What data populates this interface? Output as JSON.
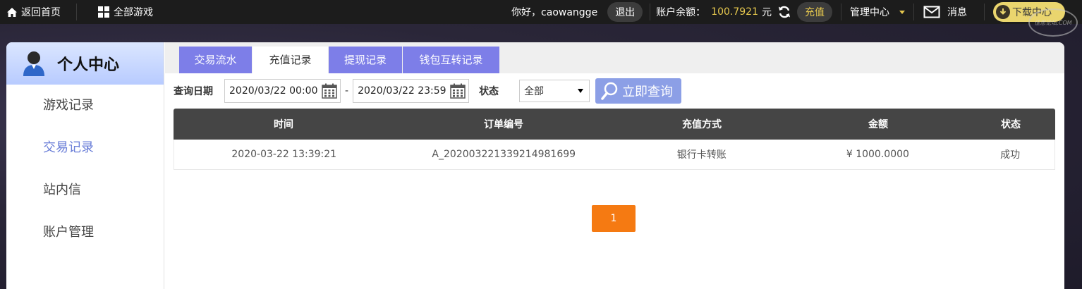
{
  "topbar": {
    "home_label": "返回首页",
    "games_label": "全部游戏",
    "greeting": "你好，caowangge",
    "logout_label": "退出",
    "balance_label": "账户余额：",
    "balance_value": "100.7921",
    "currency": "元",
    "recharge_label": "充值",
    "management_label": "管理中心",
    "messages_label": "消息",
    "download_label": "下载中心",
    "watermark_text": "佳思论坛.COM",
    "accent_color": "#e6c84e"
  },
  "sidebar": {
    "title": "个人中心",
    "items": [
      {
        "label": "游戏记录"
      },
      {
        "label": "交易记录",
        "active": true
      },
      {
        "label": "站内信"
      },
      {
        "label": "账户管理"
      }
    ]
  },
  "tabs": [
    {
      "label": "交易流水"
    },
    {
      "label": "充值记录",
      "active": true
    },
    {
      "label": "提现记录"
    },
    {
      "label": "钱包互转记录"
    }
  ],
  "filter": {
    "date_label": "查询日期",
    "start_date": "2020/03/22 00:00",
    "separator": "-",
    "end_date": "2020/03/22 23:59",
    "status_label": "状态",
    "status_selected": "全部",
    "query_label": "立即查询"
  },
  "table": {
    "columns": [
      "时间",
      "订单编号",
      "充值方式",
      "金额",
      "状态"
    ],
    "rows": [
      {
        "time": "2020-03-22 13:39:21",
        "order_no": "A_2020032213392149816​99",
        "method": "银行卡转账",
        "amount": "¥ 1000.0000",
        "status": "成功"
      }
    ]
  },
  "pagination": {
    "current_page": "1",
    "color": "#f57a12"
  }
}
